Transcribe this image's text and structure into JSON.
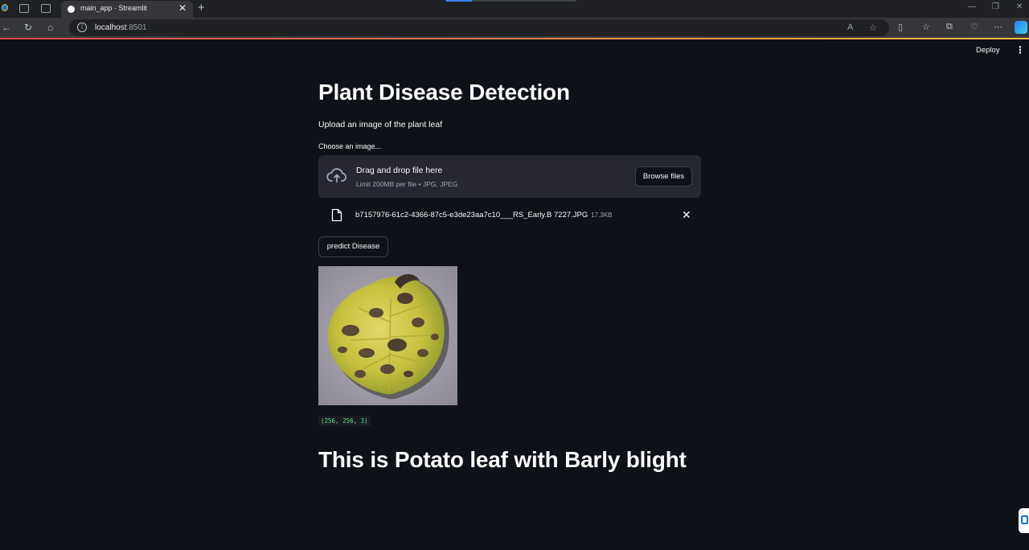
{
  "browser": {
    "tab_title": "main_app · Streamlit",
    "tab_close": "✕",
    "new_tab": "+",
    "url_host": "localhost",
    "url_port": ":8501"
  },
  "header": {
    "deploy_label": "Deploy",
    "menu_glyph": "⋮"
  },
  "main": {
    "title": "Plant Disease Detection",
    "subtitle": "Upload an image of the plant leaf",
    "uploader": {
      "label": "Choose an image...",
      "drop_text": "Drag and drop file here",
      "limit_text": "Limit 200MB per file • JPG, JPEG",
      "browse_label": "Browse files"
    },
    "file": {
      "name": "b7157976-61c2-4366-87c5-e3de23aa7c10___RS_Early.B 7227.JPG",
      "size": "17.3KB",
      "remove_glyph": "✕"
    },
    "predict_label": "predict Disease",
    "image_shape": "(256, 256, 3)",
    "result": "This is Potato leaf with Barly blight"
  },
  "icons": {
    "upload": "cloud-upload-icon",
    "file": "file-icon"
  }
}
